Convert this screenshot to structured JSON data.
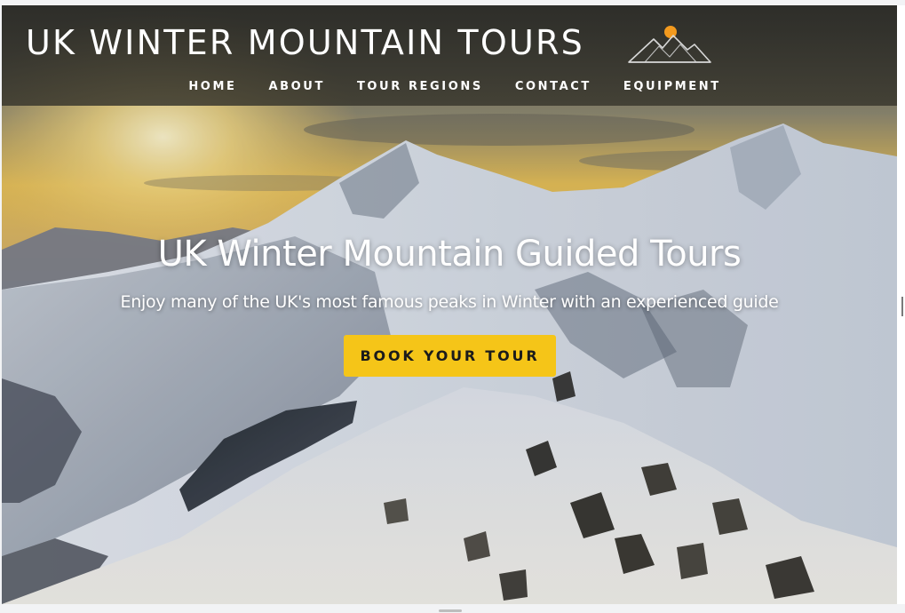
{
  "header": {
    "site_title": "UK WINTER MOUNTAIN TOURS",
    "logo_icon": "mountain-sun-logo",
    "nav": [
      "HOME",
      "ABOUT",
      "TOUR REGIONS",
      "CONTACT",
      "EQUIPMENT"
    ]
  },
  "hero": {
    "title": "UK Winter Mountain Guided Tours",
    "subtitle": "Enjoy many of the UK's most famous peaks in Winter with an experienced guide",
    "cta_label": "BOOK YOUR TOUR",
    "background": "snowy-mountain-ridge-sunrise-image"
  },
  "colors": {
    "accent": "#f5c518",
    "logo_sun": "#f39a1e",
    "header_bg": "#2f2f2a",
    "text": "#ffffff"
  }
}
